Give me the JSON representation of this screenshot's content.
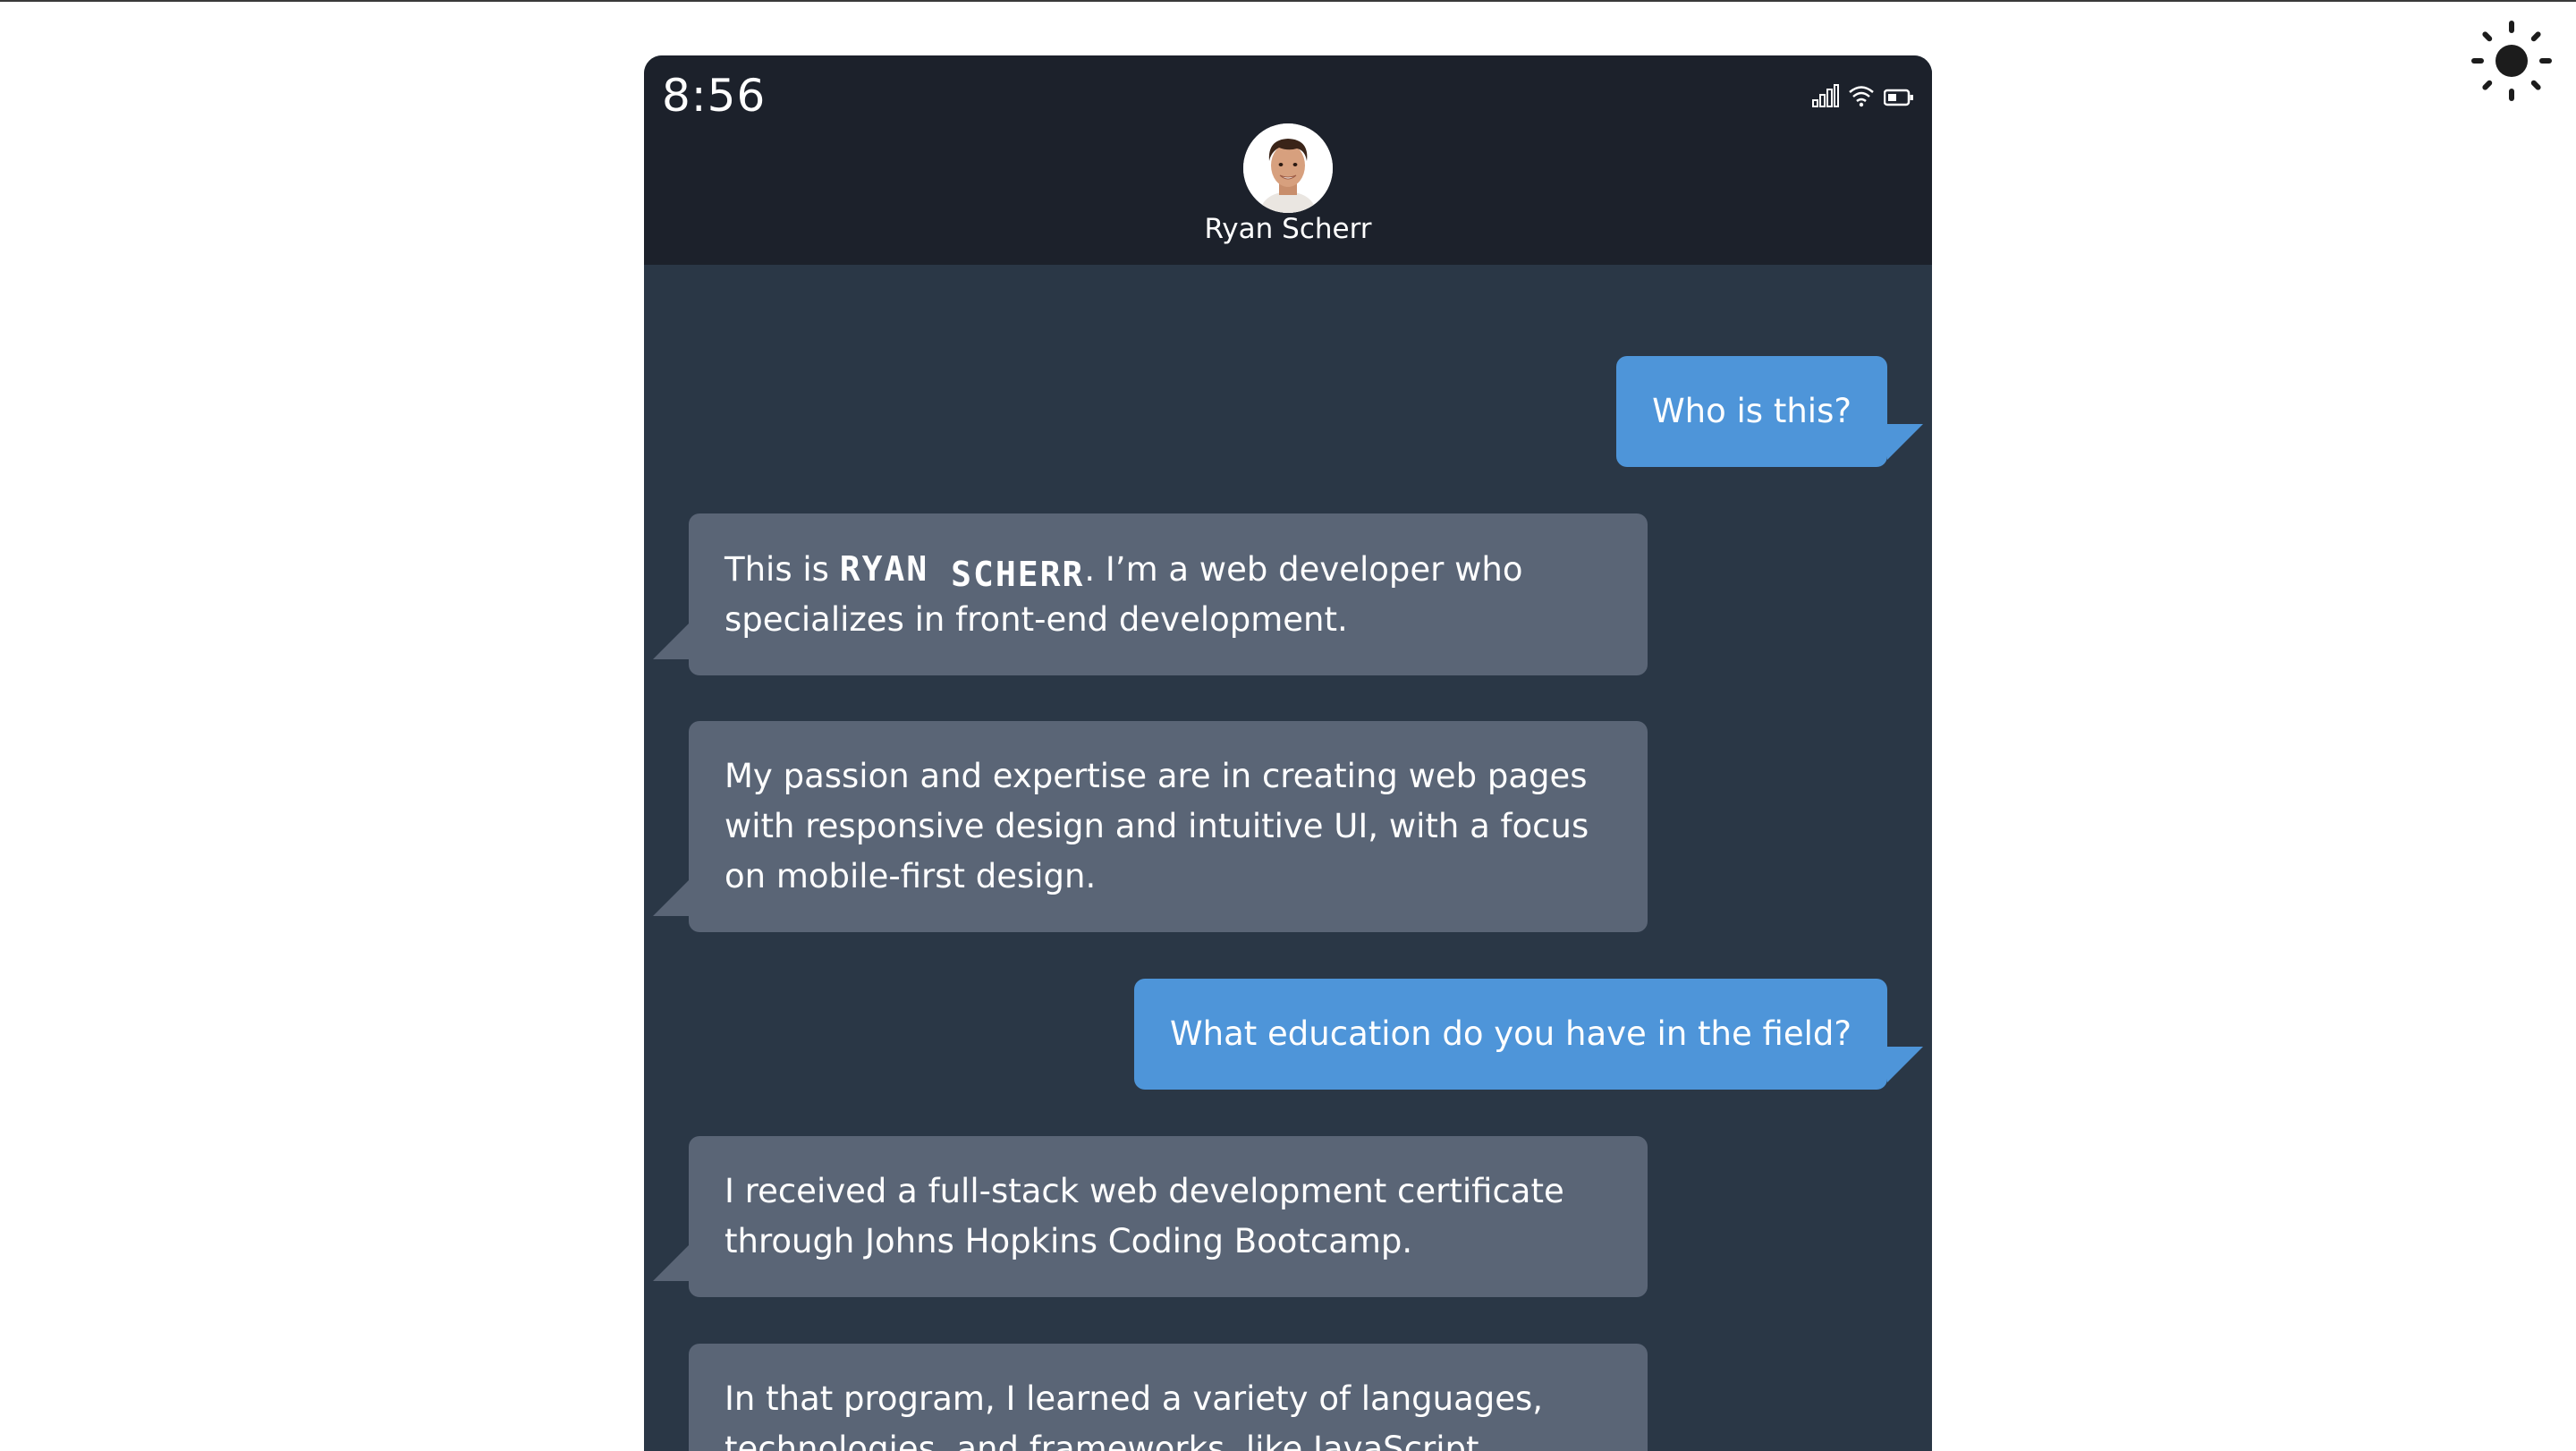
{
  "status_bar": {
    "time": "8:56",
    "icons": [
      "signal-icon",
      "wifi-icon",
      "battery-icon"
    ]
  },
  "contact": {
    "name": "Ryan Scherr",
    "avatar": "avatar-photo"
  },
  "theme_toggle": {
    "icon": "sun-icon"
  },
  "messages": [
    {
      "from": "user",
      "text": "Who is this?"
    },
    {
      "from": "contact",
      "text_before": "This is ",
      "name_word1": "RYAN",
      "name_word2": "SCHERR",
      "text_after": ". I’m a web developer who specializes in front-end development."
    },
    {
      "from": "contact",
      "text": "My passion and expertise are in creating web pages with responsive design and intuitive UI, with a focus on mobile-first design."
    },
    {
      "from": "user",
      "text": "What education do you have in the field?"
    },
    {
      "from": "contact",
      "text": "I received a full-stack web development certificate through Johns Hopkins Coding Bootcamp."
    },
    {
      "from": "contact",
      "text": "In that program, I learned a variety of languages, technologies, and frameworks, like JavaScript,"
    }
  ],
  "colors": {
    "header_bg": "#1c212b",
    "chat_bg": "#2a3746",
    "incoming_bubble": "#5a6576",
    "outgoing_bubble": "#4e95d9",
    "text": "#ffffff"
  }
}
